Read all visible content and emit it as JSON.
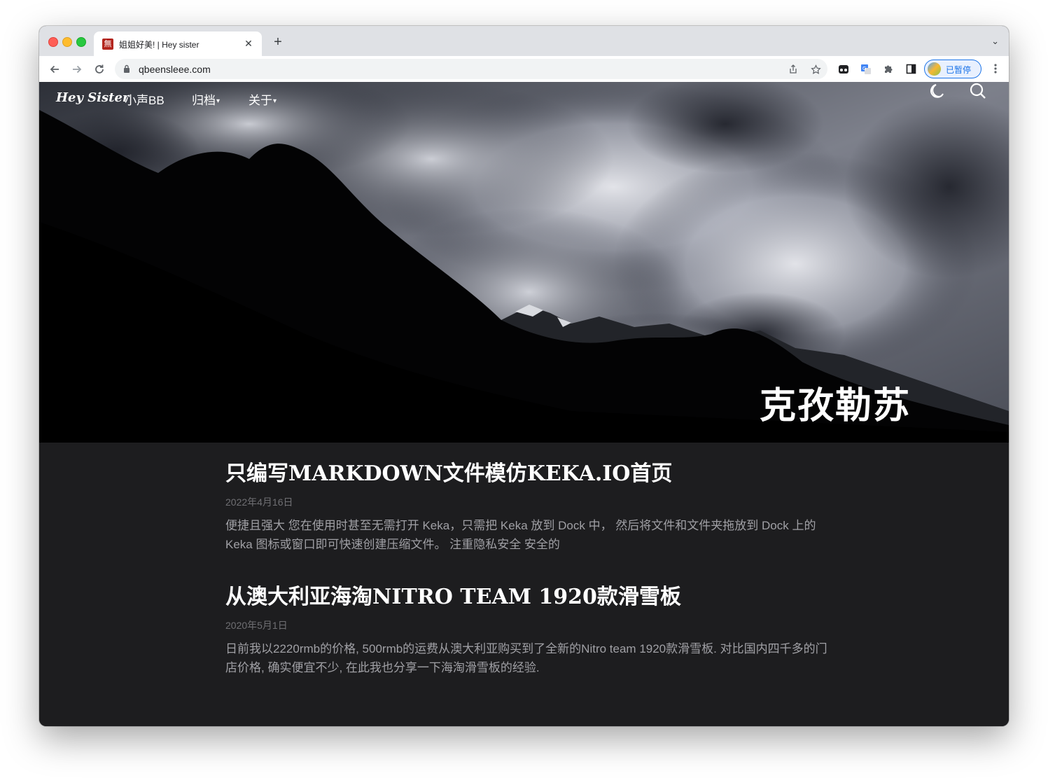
{
  "browser": {
    "tab_title": "姐姐好美! | Hey sister",
    "tab_favicon": "無",
    "tab_close": "✕",
    "new_tab": "+",
    "tab_menu": "⌄",
    "url": "qbeensleee.com",
    "profile_status": "已暂停",
    "icons": [
      "back-arrow-icon",
      "forward-arrow-icon",
      "reload-icon",
      "lock-icon",
      "share-icon",
      "star-icon",
      "extension-mask-icon",
      "translate-icon",
      "puzzle-icon",
      "sidebar-icon",
      "kebab-menu-icon"
    ]
  },
  "site": {
    "brand": "Hey Sister",
    "nav": [
      {
        "label": "小声BB"
      },
      {
        "label": "归档",
        "dropdown": true
      },
      {
        "label": "关于",
        "dropdown": true
      }
    ],
    "caret": "▾",
    "hero_title": "克孜勒苏"
  },
  "posts": [
    {
      "title": "只编写MARKDOWN文件模仿KEKA.IO首页",
      "date": "2022年4月16日",
      "excerpt": "便捷且强大 您在使用时甚至无需打开 Keka，只需把 Keka 放到 Dock 中， 然后将文件和文件夹拖放到 Dock 上的 Keka 图标或窗口即可快速创建压缩文件。 注重隐私安全 安全的"
    },
    {
      "title": "从澳大利亚海淘NITRO TEAM 1920款滑雪板",
      "date": "2020年5月1日",
      "excerpt": "日前我以2220rmb的价格, 500rmb的运费从澳大利亚购买到了全新的Nitro team 1920款滑雪板. 对比国内四千多的门店价格, 确实便宜不少, 在此我也分享一下海淘滑雪板的经验."
    }
  ],
  "colors": {
    "page_bg": "#1d1d1f",
    "title": "#ffffff",
    "date": "#6f6f73",
    "excerpt": "#a0a0a5"
  }
}
